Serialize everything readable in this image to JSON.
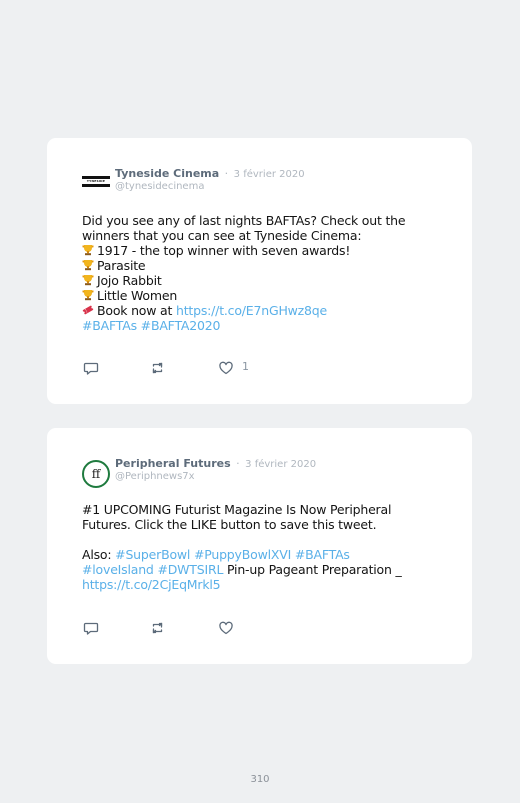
{
  "tweets": [
    {
      "name": "Tyneside Cinema",
      "separator": "·",
      "date": "3 février 2020",
      "handle": "@tynesidecinema",
      "avatar_icon": "tyneside-logo-icon",
      "logo_text": "TYNESIDE",
      "lines": {
        "l1": "Did you see any of last nights BAFTAs? Check out the",
        "l2": "winners that you can see at Tyneside Cinema:",
        "l3": "1917 - the top winner with seven awards!",
        "l4": "Parasite",
        "l5": "Jojo Rabbit",
        "l6": "Little Women",
        "l7_text": "Book now at ",
        "l7_link": "https://t.co/E7nGHwz8qe",
        "l8_link": "#BAFTAs #BAFTA2020"
      },
      "like_count": "1"
    },
    {
      "name": "Peripheral Futures",
      "separator": "·",
      "date": "3 février 2020",
      "handle": "@Periphnews7x",
      "avatar_text": "ff",
      "lines": {
        "l1": "#1 UPCOMING Futurist Magazine Is Now Peripheral",
        "l2": "Futures. Click the LIKE button to save this tweet.",
        "l3_text": "Also: ",
        "l3_link": "#SuperBowl #PuppyBowlXVI #BAFTAs",
        "l4_link": "#loveIsland #DWTSIRL",
        "l4_text": " Pin-up Pageant Preparation _",
        "l5_link": "https://t.co/2CjEqMrkl5"
      },
      "like_count": ""
    }
  ],
  "page_number": "310",
  "colors": {
    "link": "#5ab0e8",
    "name": "#5d6b7a",
    "meta": "#b0b7bf",
    "background": "#eef0f2"
  },
  "icons": [
    "reply-icon",
    "retweet-icon",
    "heart-icon",
    "trophy-icon",
    "ticket-icon"
  ]
}
